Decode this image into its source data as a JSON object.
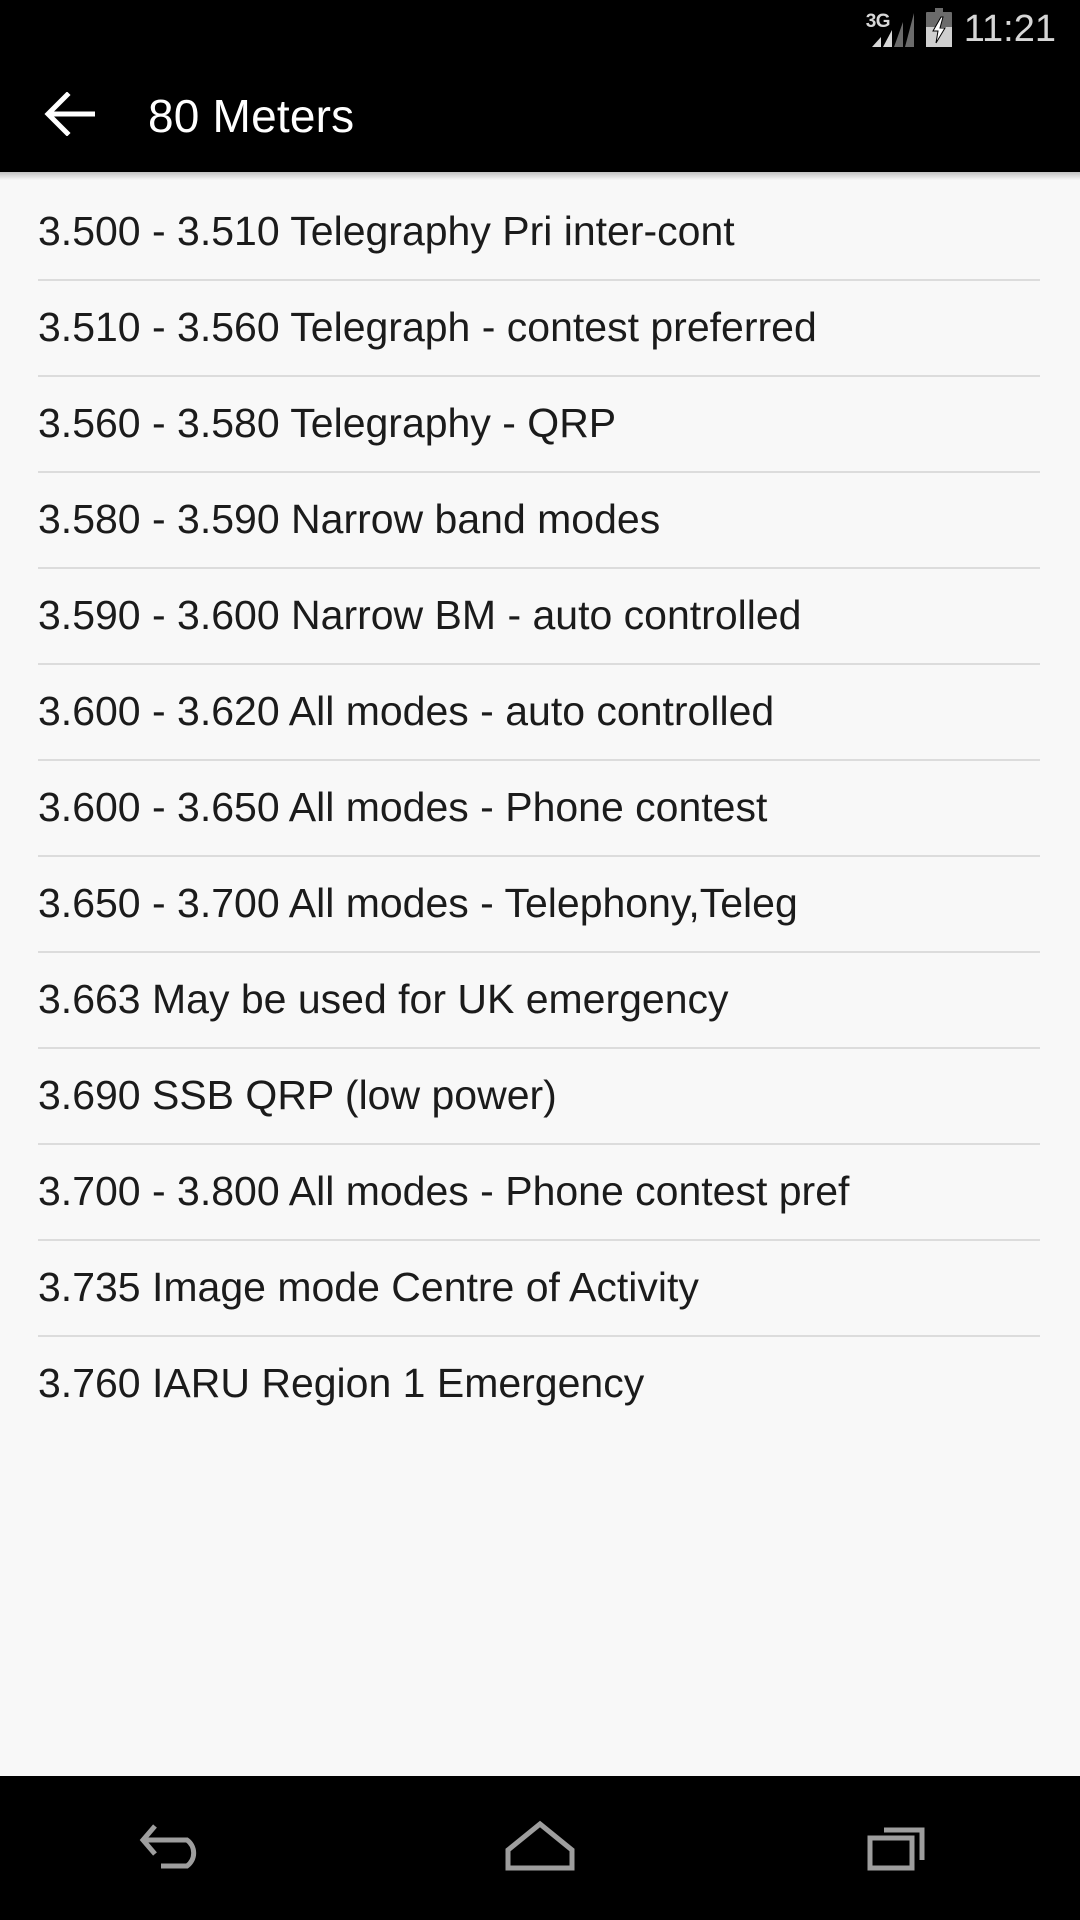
{
  "status_bar": {
    "network_label": "3G",
    "time": "11:21",
    "signal_icon": "signal-bars-icon",
    "battery_icon": "battery-charging-icon",
    "signal_bars_filled": 2,
    "signal_bars_total": 4,
    "colors": {
      "background": "#000000",
      "icon_active": "#d8d8d8",
      "icon_inactive": "#6b6b6b",
      "text": "#d6d6d6"
    }
  },
  "app_bar": {
    "back_icon": "arrow-left-icon",
    "title": "80 Meters",
    "colors": {
      "background": "#000000",
      "text": "#ffffff"
    }
  },
  "list": {
    "items": [
      {
        "label": "3.500 - 3.510 Telegraphy Pri inter-cont"
      },
      {
        "label": "3.510 - 3.560 Telegraph - contest preferred"
      },
      {
        "label": "3.560 - 3.580 Telegraphy - QRP"
      },
      {
        "label": "3.580 - 3.590 Narrow band modes"
      },
      {
        "label": "3.590 - 3.600 Narrow BM - auto controlled"
      },
      {
        "label": "3.600 - 3.620 All modes - auto controlled"
      },
      {
        "label": "3.600 - 3.650 All modes - Phone contest"
      },
      {
        "label": "3.650 - 3.700 All modes - Telephony,Teleg"
      },
      {
        "label": "3.663 May be used for UK emergency"
      },
      {
        "label": "3.690 SSB QRP (low power)"
      },
      {
        "label": "3.700 - 3.800 All modes - Phone contest pref"
      },
      {
        "label": "3.735 Image mode Centre of Activity"
      },
      {
        "label": "3.760 IARU Region 1 Emergency"
      }
    ],
    "colors": {
      "background": "#f8f8f8",
      "text": "#1b1b1b",
      "divider": "#dcdcdc"
    }
  },
  "nav_bar": {
    "back_icon": "nav-back-icon",
    "home_icon": "nav-home-icon",
    "recents_icon": "nav-recents-icon",
    "colors": {
      "background": "#000000",
      "icon": "#9e9e9e"
    }
  }
}
